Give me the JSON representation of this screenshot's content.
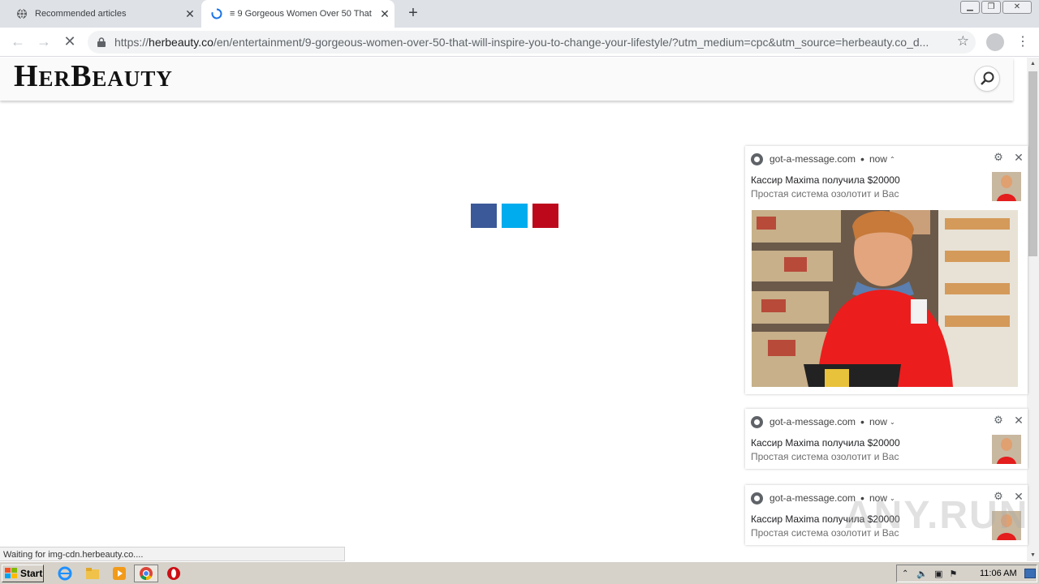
{
  "browser": {
    "tabs": [
      {
        "title": "Recommended articles",
        "active": false
      },
      {
        "title": "≡ 9 Gorgeous Women Over 50 That",
        "active": true
      }
    ],
    "new_tab_label": "+",
    "close_label": "✕",
    "url_prefix": "https://",
    "url_host": "herbeauty.co",
    "url_rest": "/en/entertainment/9-gorgeous-women-over-50-that-will-inspire-you-to-change-your-lifestyle/?utm_medium=cpc&utm_source=herbeauty.co_d...",
    "nav": {
      "back": "←",
      "forward": "→",
      "stop": "✕"
    },
    "star": "☆",
    "menu": "⋮"
  },
  "page": {
    "logo": "HerBeauty",
    "share_buttons": [
      "facebook",
      "twitter",
      "pinterest"
    ],
    "colors": {
      "facebook": "#3b5998",
      "twitter": "#00aced",
      "pinterest": "#bd081c"
    }
  },
  "notifications": [
    {
      "source": "got-a-message.com",
      "time": "now",
      "chevron": "⌃",
      "title": "Кассир Maxima получила $20000",
      "body": "Простая система озолотит и Вас",
      "expanded": true
    },
    {
      "source": "got-a-message.com",
      "time": "now",
      "chevron": "⌄",
      "title": "Кассир Maxima получила $20000",
      "body": "Простая система озолотит и Вас",
      "expanded": false
    },
    {
      "source": "got-a-message.com",
      "time": "now",
      "chevron": "⌄",
      "title": "Кассир Maxima получила $20000",
      "body": "Простая система озолотит и Вас",
      "expanded": false
    }
  ],
  "notif_separator": "•",
  "status_text": "Waiting for img-cdn.herbeauty.co....",
  "watermark": "ANY.RUN",
  "taskbar": {
    "start_label": "Start",
    "clock": "11:06 AM"
  }
}
